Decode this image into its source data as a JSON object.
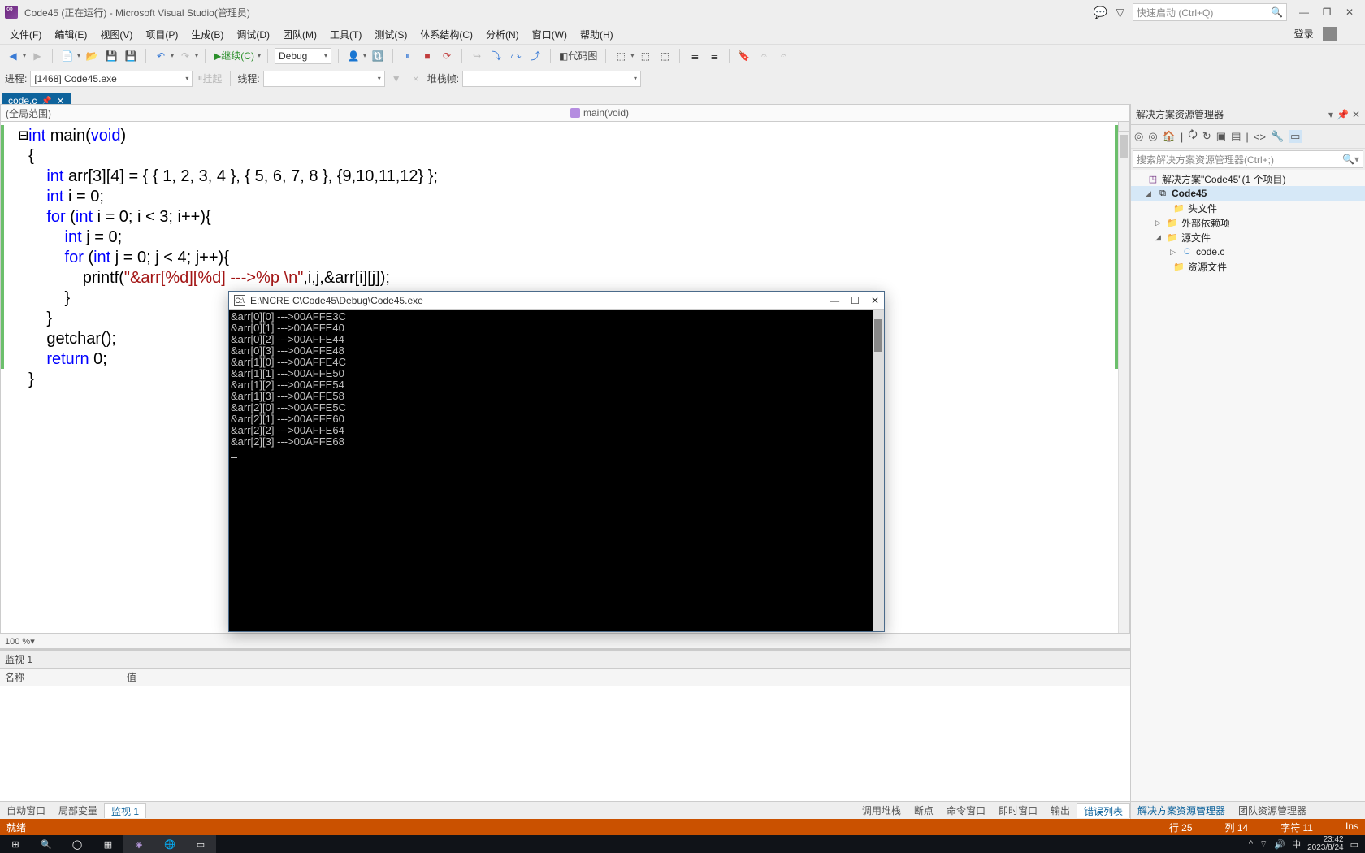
{
  "title": "Code45 (正在运行) - Microsoft Visual Studio(管理员)",
  "quick_launch_placeholder": "快速启动 (Ctrl+Q)",
  "login": "登录",
  "menu": [
    "文件(F)",
    "编辑(E)",
    "视图(V)",
    "项目(P)",
    "生成(B)",
    "调试(D)",
    "团队(M)",
    "工具(T)",
    "测试(S)",
    "体系结构(C)",
    "分析(N)",
    "窗口(W)",
    "帮助(H)"
  ],
  "toolbar": {
    "continue": "继续(C)",
    "config": "Debug",
    "codemap": "代码图"
  },
  "toolbar2": {
    "process_label": "进程:",
    "process": "[1468] Code45.exe",
    "suspend": "挂起",
    "thread": "线程:",
    "stackframe": "堆栈帧:"
  },
  "tab": {
    "name": "code.c"
  },
  "nav": {
    "scope": "(全局范围)",
    "member": "main(void)"
  },
  "code": {
    "l1a": "int",
    "l1b": " main(",
    "l1c": "void",
    "l1d": ")",
    "l2": "{",
    "l3a": "    int",
    "l3b": " arr[3][4] = { { 1, 2, 3, 4 }, { 5, 6, 7, 8 }, {9,10,11,12} };",
    "l4a": "    int",
    "l4b": " i = 0;",
    "l5a": "    for",
    "l5b": " (",
    "l5c": "int",
    "l5d": " i = 0; i < 3; i++){",
    "l6a": "        int",
    "l6b": " j = 0;",
    "l7a": "        for",
    "l7b": " (",
    "l7c": "int",
    "l7d": " j = 0; j < 4; j++){",
    "l8a": "            printf(",
    "l8b": "\"&arr[%d][%d] --->%p \\n\"",
    "l8c": ",i,j,&arr[i][j]);",
    "l9": "        }",
    "l10": "    }",
    "l11": "    getchar();",
    "l12a": "    return",
    "l12b": " 0;",
    "l13": "}"
  },
  "zoom": "100 %",
  "watch": {
    "title": "监视 1",
    "col_name": "名称",
    "col_value": "值"
  },
  "bottom_tabs_left": [
    "自动窗口",
    "局部变量",
    "监视 1"
  ],
  "bottom_tabs_right": [
    "调用堆栈",
    "断点",
    "命令窗口",
    "即时窗口",
    "输出",
    "错误列表"
  ],
  "right": {
    "panel_title": "解决方案资源管理器",
    "search_placeholder": "搜索解决方案资源管理器(Ctrl+;)",
    "sln": "解决方案\"Code45\"(1 个项目)",
    "project": "Code45",
    "folder_headers": "头文件",
    "folder_extern": "外部依赖项",
    "folder_source": "源文件",
    "file_code": "code.c",
    "folder_res": "资源文件",
    "tab1": "解决方案资源管理器",
    "tab2": "团队资源管理器"
  },
  "status": {
    "ready": "就绪",
    "line": "行 25",
    "col": "列 14",
    "char": "字符 11",
    "ins": "Ins"
  },
  "console": {
    "title": "E:\\NCRE C\\Code45\\Debug\\Code45.exe",
    "lines": [
      "&arr[0][0] --->00AFFE3C",
      "&arr[0][1] --->00AFFE40",
      "&arr[0][2] --->00AFFE44",
      "&arr[0][3] --->00AFFE48",
      "&arr[1][0] --->00AFFE4C",
      "&arr[1][1] --->00AFFE50",
      "&arr[1][2] --->00AFFE54",
      "&arr[1][3] --->00AFFE58",
      "&arr[2][0] --->00AFFE5C",
      "&arr[2][1] --->00AFFE60",
      "&arr[2][2] --->00AFFE64",
      "&arr[2][3] --->00AFFE68"
    ]
  },
  "tray": {
    "ime": "中",
    "time": "23:42",
    "date": "2023/8/24"
  }
}
